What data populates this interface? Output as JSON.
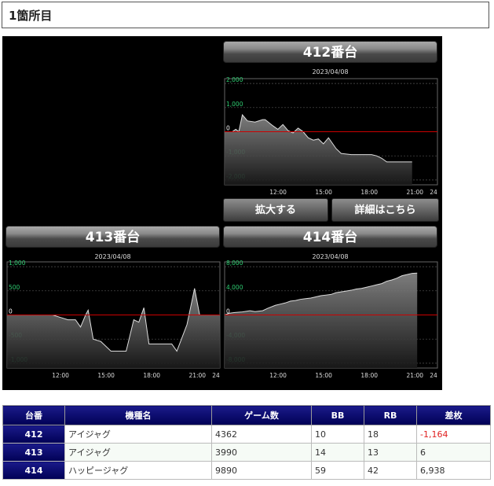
{
  "page": {
    "title": "1箇所目"
  },
  "panels": {
    "p412": {
      "header": "412番台",
      "date": "2023/04/08",
      "y_ticks": [
        "2,000",
        "1,000",
        "0",
        "-1,000",
        "-2,000"
      ],
      "x_ticks": [
        "12:00",
        "15:00",
        "18:00",
        "21:00",
        "24"
      ],
      "ylim": [
        -2200,
        2200
      ],
      "series": [
        [
          0,
          0
        ],
        [
          0.1,
          0
        ],
        [
          0.15,
          0
        ],
        [
          0.22,
          0.1
        ],
        [
          0.28,
          0
        ],
        [
          0.35,
          0.7
        ],
        [
          0.45,
          0.45
        ],
        [
          0.6,
          0.4
        ],
        [
          0.75,
          0.5
        ],
        [
          0.8,
          0.5
        ],
        [
          0.95,
          0.25
        ],
        [
          1.05,
          0.1
        ],
        [
          1.15,
          0.3
        ],
        [
          1.25,
          0.05
        ],
        [
          1.35,
          -0.05
        ],
        [
          1.45,
          0.15
        ],
        [
          1.55,
          0
        ],
        [
          1.65,
          -0.25
        ],
        [
          1.75,
          -0.35
        ],
        [
          1.85,
          -0.3
        ],
        [
          1.95,
          -0.5
        ],
        [
          2.05,
          -0.25
        ],
        [
          2.1,
          -0.4
        ],
        [
          2.2,
          -0.7
        ],
        [
          2.3,
          -0.9
        ],
        [
          2.5,
          -0.95
        ],
        [
          2.7,
          -0.95
        ],
        [
          2.9,
          -0.95
        ],
        [
          3.0,
          -1.0
        ],
        [
          3.1,
          -1.1
        ],
        [
          3.2,
          -1.25
        ],
        [
          3.5,
          -1.25
        ],
        [
          3.7,
          -1.25
        ]
      ]
    },
    "p413": {
      "header": "413番台",
      "date": "2023/04/08",
      "y_ticks": [
        "1,000",
        "500",
        "0",
        "-500",
        "-1,000"
      ],
      "x_ticks": [
        "12:00",
        "15:00",
        "18:00",
        "21:00",
        "24"
      ],
      "ylim": [
        -1100,
        1100
      ],
      "series": [
        [
          0,
          0
        ],
        [
          0.5,
          0
        ],
        [
          0.9,
          0
        ],
        [
          1.05,
          -0.05
        ],
        [
          1.2,
          -0.1
        ],
        [
          1.35,
          -0.1
        ],
        [
          1.45,
          -0.25
        ],
        [
          1.55,
          0
        ],
        [
          1.6,
          0.1
        ],
        [
          1.7,
          -0.5
        ],
        [
          1.85,
          -0.55
        ],
        [
          1.95,
          -0.65
        ],
        [
          2.05,
          -0.75
        ],
        [
          2.35,
          -0.75
        ],
        [
          2.5,
          -0.1
        ],
        [
          2.6,
          -0.15
        ],
        [
          2.7,
          0.15
        ],
        [
          2.8,
          -0.6
        ],
        [
          3.1,
          -0.6
        ],
        [
          3.25,
          -0.6
        ],
        [
          3.35,
          -0.75
        ],
        [
          3.55,
          -0.2
        ],
        [
          3.7,
          0.55
        ],
        [
          3.8,
          0.0
        ],
        [
          4.2,
          0.0
        ]
      ]
    },
    "p414": {
      "header": "414番台",
      "date": "2023/04/08",
      "y_ticks": [
        "8,000",
        "4,000",
        "0",
        "-4,000",
        "-8,000"
      ],
      "x_ticks": [
        "12:00",
        "15:00",
        "18:00",
        "21:00",
        "24"
      ],
      "ylim": [
        -8800,
        8800
      ],
      "series": [
        [
          0,
          0
        ],
        [
          0.1,
          0.3
        ],
        [
          0.2,
          0.4
        ],
        [
          0.35,
          0.5
        ],
        [
          0.5,
          0.7
        ],
        [
          0.6,
          0.55
        ],
        [
          0.75,
          0.7
        ],
        [
          0.85,
          1.1
        ],
        [
          1.0,
          1.6
        ],
        [
          1.1,
          1.8
        ],
        [
          1.2,
          2.0
        ],
        [
          1.3,
          2.3
        ],
        [
          1.4,
          2.4
        ],
        [
          1.5,
          2.6
        ],
        [
          1.6,
          2.7
        ],
        [
          1.7,
          2.8
        ],
        [
          1.8,
          3.0
        ],
        [
          1.9,
          3.2
        ],
        [
          2.0,
          3.3
        ],
        [
          2.1,
          3.4
        ],
        [
          2.2,
          3.7
        ],
        [
          2.35,
          3.9
        ],
        [
          2.5,
          4.1
        ],
        [
          2.6,
          4.3
        ],
        [
          2.7,
          4.4
        ],
        [
          2.8,
          4.6
        ],
        [
          2.9,
          4.8
        ],
        [
          3.0,
          5.0
        ],
        [
          3.1,
          5.2
        ],
        [
          3.2,
          5.6
        ],
        [
          3.3,
          5.8
        ],
        [
          3.4,
          6.1
        ],
        [
          3.5,
          6.5
        ],
        [
          3.6,
          6.7
        ],
        [
          3.7,
          6.9
        ],
        [
          3.8,
          6.938
        ]
      ]
    }
  },
  "buttons": {
    "zoom": "拡大する",
    "details": "詳細はこちら"
  },
  "table": {
    "headers": [
      "台番",
      "機種名",
      "ゲーム数",
      "BB",
      "RB",
      "差枚"
    ],
    "rows": [
      {
        "id": "412",
        "name": "アイジャグ",
        "games": "4362",
        "bb": "10",
        "rb": "18",
        "diff": "-1,164"
      },
      {
        "id": "413",
        "name": "アイジャグ",
        "games": "3990",
        "bb": "14",
        "rb": "13",
        "diff": "6"
      },
      {
        "id": "414",
        "name": "ハッピージャグ",
        "games": "9890",
        "bb": "59",
        "rb": "42",
        "diff": "6,938"
      }
    ]
  }
}
